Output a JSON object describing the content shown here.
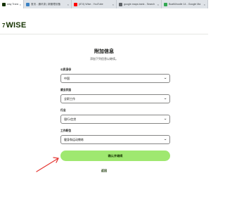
{
  "browser": {
    "tabs": [
      {
        "title": "way Transfers | M",
        "favicon_color": "#163300",
        "active": true
      },
      {
        "title": "首页 - 通讯录 | 新管理设备",
        "favicon_color": "#3b82c4",
        "active": false
      },
      {
        "title": "(874) Wise - YouTube",
        "favicon_color": "#ff0000",
        "active": false
      },
      {
        "title": "google.maps.bank - Search",
        "favicon_color": "#5f6368",
        "active": false
      },
      {
        "title": "BoatWoodle 14 - Google Ma",
        "favicon_color": "#34a853",
        "active": false
      }
    ]
  },
  "header": {
    "logo_mark": "7",
    "logo_word": "WISE"
  },
  "main": {
    "title": "附加信息",
    "subtitle": "添加下列信息以继续。",
    "fields": [
      {
        "label": "公民身份",
        "value": "中国"
      },
      {
        "label": "就业状态",
        "value": "全职工作"
      },
      {
        "label": "行业",
        "value": "银行/信贷"
      },
      {
        "label": "工作职位",
        "value": "健身和运动教练"
      }
    ],
    "continue_label": "确认并继续",
    "back_label": "返回"
  },
  "colors": {
    "accent": "#9fe870",
    "brand_dark": "#163300",
    "annotation": "#e53935"
  }
}
